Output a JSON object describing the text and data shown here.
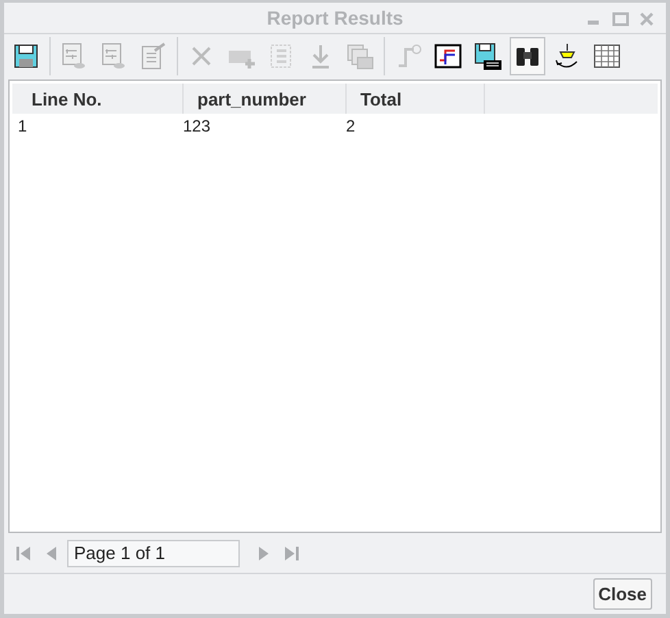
{
  "window": {
    "title": "Report Results",
    "controls": [
      {
        "kind": "minimize"
      },
      {
        "kind": "maximize"
      },
      {
        "kind": "close"
      }
    ]
  },
  "toolbar": [
    {
      "kind": "save",
      "disabled": false,
      "pressed": false
    },
    {
      "kind": "sep"
    },
    {
      "kind": "report",
      "disabled": true,
      "pressed": false
    },
    {
      "kind": "report",
      "disabled": true,
      "pressed": false
    },
    {
      "kind": "notes",
      "disabled": true,
      "pressed": false
    },
    {
      "kind": "sep"
    },
    {
      "kind": "delete",
      "disabled": true,
      "pressed": false
    },
    {
      "kind": "add",
      "disabled": true,
      "pressed": false
    },
    {
      "kind": "list",
      "disabled": true,
      "pressed": false
    },
    {
      "kind": "download",
      "disabled": true,
      "pressed": false
    },
    {
      "kind": "copies",
      "disabled": true,
      "pressed": false
    },
    {
      "kind": "sep"
    },
    {
      "kind": "pipe",
      "disabled": true,
      "pressed": false
    },
    {
      "kind": "diagram",
      "disabled": false,
      "pressed": false
    },
    {
      "kind": "savexml",
      "disabled": false,
      "pressed": false
    },
    {
      "kind": "binoculars",
      "disabled": false,
      "pressed": true
    },
    {
      "kind": "rotate",
      "disabled": false,
      "pressed": false
    },
    {
      "kind": "grid",
      "disabled": false,
      "pressed": false
    }
  ],
  "table": {
    "columns": [
      "Line No.",
      "part_number",
      "Total"
    ],
    "rows": [
      [
        "1",
        "123",
        "2"
      ]
    ]
  },
  "pager": {
    "page_text": "Page 1 of 1",
    "buttons": [
      {
        "kind": "first",
        "disabled": true
      },
      {
        "kind": "prev",
        "disabled": true
      },
      {
        "kind": "next",
        "disabled": true
      },
      {
        "kind": "last",
        "disabled": true
      }
    ]
  },
  "buttons": [
    "Close"
  ]
}
